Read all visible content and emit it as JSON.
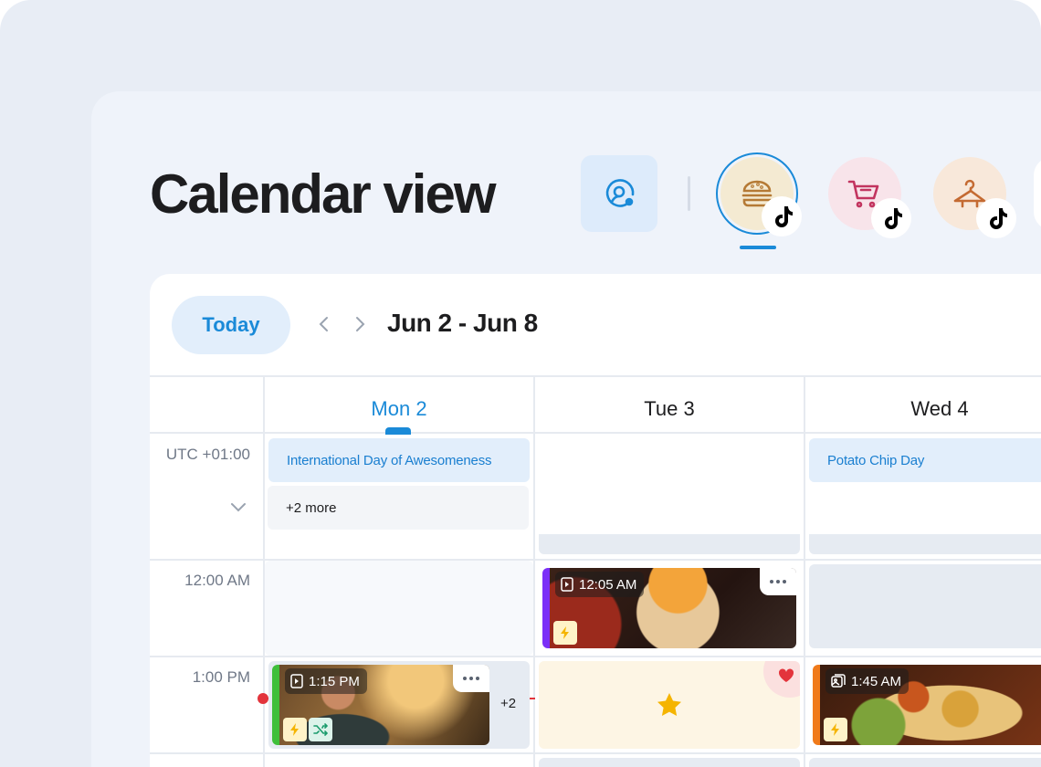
{
  "header": {
    "title": "Calendar view"
  },
  "accounts": [
    {
      "icon": "burger-icon",
      "platform": "tiktok-icon",
      "selected": true,
      "color": "#f4ead2"
    },
    {
      "icon": "shopping-cart-icon",
      "platform": "tiktok-icon",
      "selected": false,
      "color": "#f8e4ea"
    },
    {
      "icon": "hanger-icon",
      "platform": "tiktok-icon",
      "selected": false,
      "color": "#f8e8da"
    }
  ],
  "toolbar": {
    "today_label": "Today",
    "date_range": "Jun 2 - Jun 8"
  },
  "days": [
    {
      "label": "Mon 2",
      "active": true
    },
    {
      "label": "Tue 3",
      "active": false
    },
    {
      "label": "Wed 4",
      "active": false
    }
  ],
  "timezone": "UTC +01:00",
  "all_day": {
    "mon": {
      "event": "International Day of Awesomeness",
      "more": "+2 more"
    },
    "wed": {
      "event": "Potato Chip Day"
    }
  },
  "times": [
    "12:00 AM",
    "1:00 PM"
  ],
  "posts": {
    "tue_1200": {
      "time": "12:05 AM",
      "type": "video-icon"
    },
    "mon_1300": {
      "time": "1:15 PM",
      "type": "video-icon",
      "overflow": "+2"
    },
    "wed_1300": {
      "time": "1:45 AM",
      "type": "gallery-icon"
    }
  },
  "colors": {
    "accent": "#1a8ad8",
    "now_line": "#e3343c",
    "purple_bar": "#7b2ff7",
    "green_bar": "#3fbf3a",
    "orange_bar": "#f07a1a",
    "lightning": "#f5b400"
  }
}
